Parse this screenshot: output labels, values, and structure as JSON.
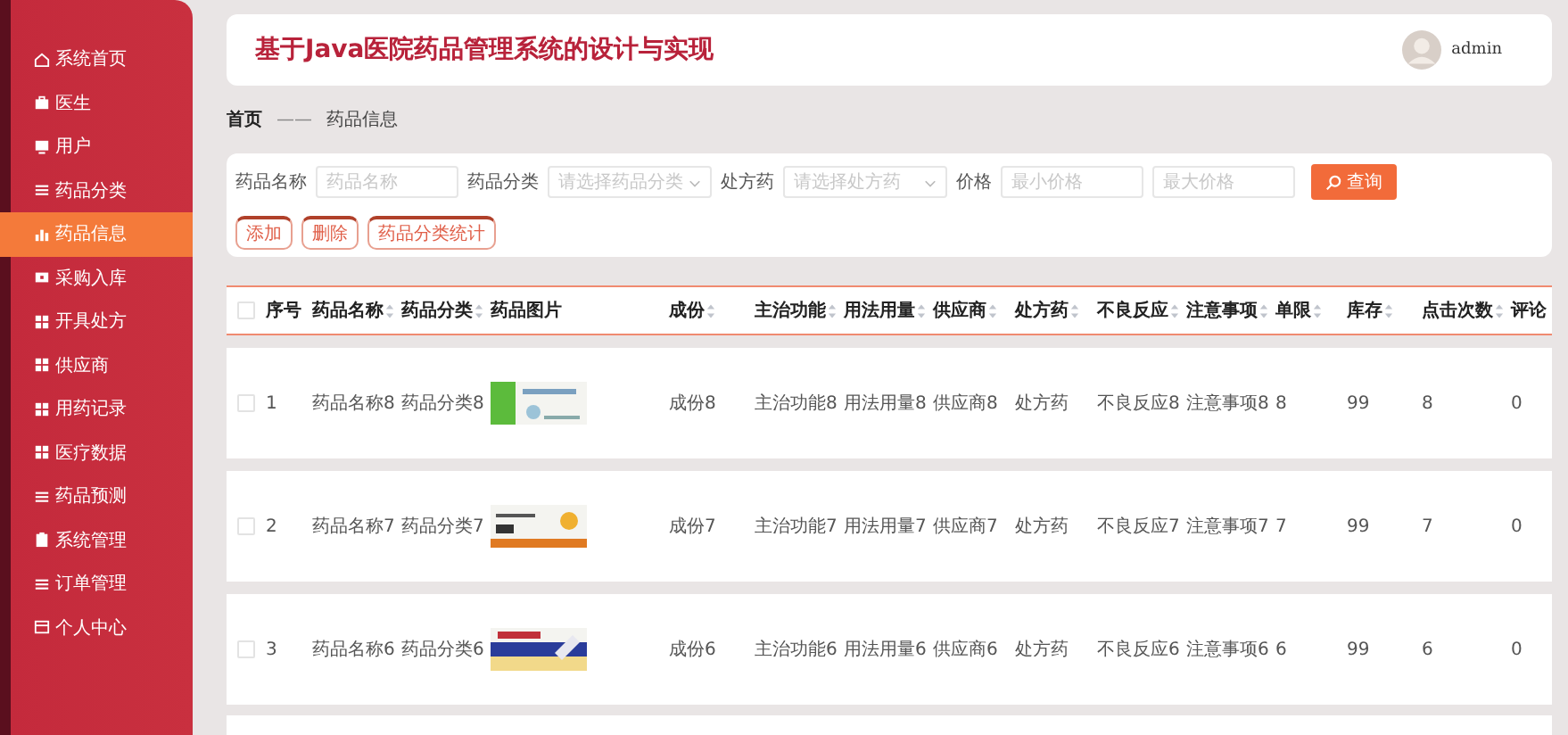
{
  "sidebar": {
    "items": [
      {
        "label": "系统首页",
        "selected": false
      },
      {
        "label": "医生",
        "selected": false
      },
      {
        "label": "用户",
        "selected": false
      },
      {
        "label": "药品分类",
        "selected": false
      },
      {
        "label": "药品信息",
        "selected": true
      },
      {
        "label": "采购入库",
        "selected": false
      },
      {
        "label": "开具处方",
        "selected": false
      },
      {
        "label": "供应商",
        "selected": false
      },
      {
        "label": "用药记录",
        "selected": false
      },
      {
        "label": "医疗数据",
        "selected": false
      },
      {
        "label": "药品预测",
        "selected": false
      },
      {
        "label": "系统管理",
        "selected": false
      },
      {
        "label": "订单管理",
        "selected": false
      },
      {
        "label": "个人中心",
        "selected": false
      }
    ]
  },
  "header": {
    "title": "基于Java医院药品管理系统的设计与实现",
    "user": "admin"
  },
  "breadcrumb": {
    "home": "首页",
    "separator": "——",
    "current": "药品信息"
  },
  "search": {
    "fields": [
      {
        "label": "药品名称",
        "kind": "input",
        "placeholder": "药品名称"
      },
      {
        "label": "药品分类",
        "kind": "select",
        "placeholder": "请选择药品分类"
      },
      {
        "label": "处方药",
        "kind": "select",
        "placeholder": "请选择处方药"
      },
      {
        "label": "价格",
        "kind": "input",
        "placeholder": "最小价格"
      },
      {
        "kind": "input",
        "placeholder": "最大价格"
      }
    ],
    "button": "查询"
  },
  "actions": [
    "添加",
    "删除",
    "药品分类统计"
  ],
  "table": {
    "all_selected": false,
    "columns": [
      {
        "label": "序号",
        "kind": "text",
        "sortable": false
      },
      {
        "label": "药品名称",
        "kind": "text",
        "sortable": true
      },
      {
        "label": "药品分类",
        "kind": "text",
        "sortable": true
      },
      {
        "label": "药品图片",
        "sortable": false
      },
      {
        "label": "成份",
        "kind": "text",
        "sortable": true
      },
      {
        "label": "主治功能",
        "kind": "text",
        "sortable": true
      },
      {
        "label": "用法用量",
        "kind": "text",
        "sortable": true
      },
      {
        "label": "供应商",
        "kind": "text",
        "sortable": true
      },
      {
        "label": "处方药",
        "kind": "text",
        "sortable": true
      },
      {
        "label": "不良反应",
        "kind": "text",
        "sortable": true
      },
      {
        "label": "注意事项",
        "kind": "text",
        "sortable": true
      },
      {
        "label": "单限",
        "kind": "text",
        "sortable": true
      },
      {
        "label": "库存",
        "kind": "text",
        "sortable": true
      },
      {
        "label": "点击次数",
        "kind": "text",
        "sortable": true
      },
      {
        "label": "评论",
        "kind": "text",
        "sortable": false
      }
    ],
    "rows": [
      {
        "selected": false,
        "cells": [
          "1",
          "药品名称8",
          "药品分类8",
          "",
          "成份8",
          "主治功能8",
          "用法用量8",
          "供应商8",
          "处方药",
          "不良反应8",
          "注意事项8",
          "8",
          "99",
          "8",
          "0"
        ]
      },
      {
        "selected": false,
        "cells": [
          "2",
          "药品名称7",
          "药品分类7",
          "",
          "成份7",
          "主治功能7",
          "用法用量7",
          "供应商7",
          "处方药",
          "不良反应7",
          "注意事项7",
          "7",
          "99",
          "7",
          "0"
        ]
      },
      {
        "selected": false,
        "cells": [
          "3",
          "药品名称6",
          "药品分类6",
          "",
          "成份6",
          "主治功能6",
          "用法用量6",
          "供应商6",
          "处方药",
          "不良反应6",
          "注意事项6",
          "6",
          "99",
          "6",
          "0"
        ]
      }
    ]
  }
}
